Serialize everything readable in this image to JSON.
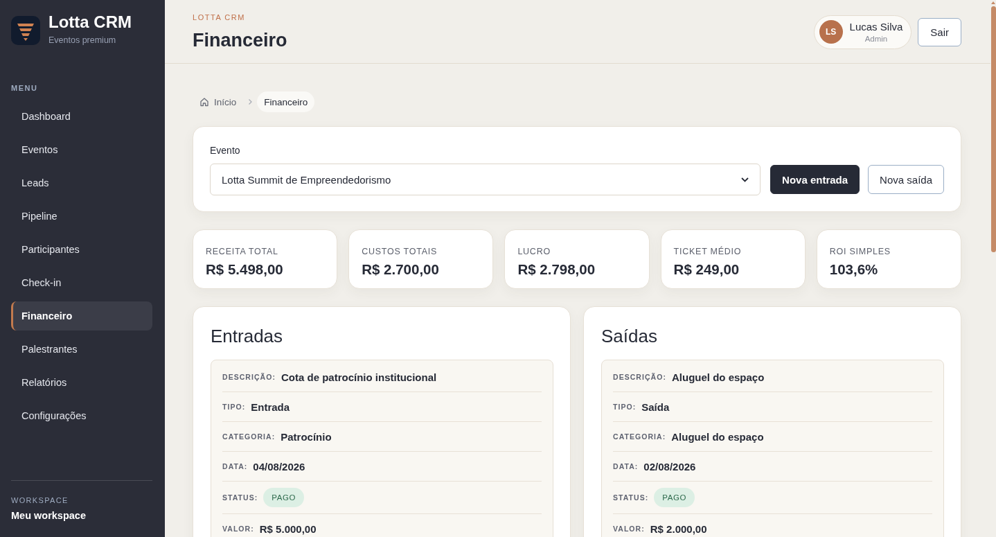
{
  "sidebar": {
    "brand": {
      "name": "Lotta CRM",
      "tagline": "Eventos premium"
    },
    "menu_label": "MENU",
    "items": [
      {
        "label": "Dashboard",
        "selected": false
      },
      {
        "label": "Eventos",
        "selected": false
      },
      {
        "label": "Leads",
        "selected": false
      },
      {
        "label": "Pipeline",
        "selected": false
      },
      {
        "label": "Participantes",
        "selected": false
      },
      {
        "label": "Check-in",
        "selected": false
      },
      {
        "label": "Financeiro",
        "selected": true
      },
      {
        "label": "Palestrantes",
        "selected": false
      },
      {
        "label": "Relatórios",
        "selected": false
      },
      {
        "label": "Configurações",
        "selected": false
      }
    ],
    "workspace": {
      "label": "WORKSPACE",
      "name": "Meu workspace"
    }
  },
  "header": {
    "eyebrow": "LOTTA CRM",
    "title": "Financeiro",
    "user": {
      "initials": "LS",
      "name": "Lucas Silva",
      "role": "Admin"
    },
    "logout": "Sair"
  },
  "breadcrumb": [
    {
      "label": "Início",
      "current": false
    },
    {
      "label": "Financeiro",
      "current": true
    }
  ],
  "event_filter": {
    "label": "Evento",
    "value": "Lotta Summit de Empreendedorismo",
    "buttons": [
      {
        "label": "Nova entrada",
        "kind": "primary"
      },
      {
        "label": "Nova saída",
        "kind": "secondary"
      }
    ]
  },
  "kpis": [
    {
      "label": "RECEITA TOTAL",
      "value": "R$ 5.498,00"
    },
    {
      "label": "CUSTOS TOTAIS",
      "value": "R$ 2.700,00"
    },
    {
      "label": "LUCRO",
      "value": "R$ 2.798,00"
    },
    {
      "label": "TICKET MÉDIO",
      "value": "R$ 249,00"
    },
    {
      "label": "ROI SIMPLES",
      "value": "103,6%"
    }
  ],
  "panels": [
    {
      "title": "Entradas",
      "records": [
        {
          "fields": [
            {
              "label": "DESCRIÇÃO:",
              "value": "Cota de patrocínio institucional",
              "kind": "text"
            },
            {
              "label": "TIPO:",
              "value": "Entrada",
              "kind": "text"
            },
            {
              "label": "CATEGORIA:",
              "value": "Patrocínio",
              "kind": "text"
            },
            {
              "label": "DATA:",
              "value": "04/08/2026",
              "kind": "text"
            },
            {
              "label": "STATUS:",
              "value": "PAGO",
              "kind": "badge"
            },
            {
              "label": "VALOR:",
              "value": "R$ 5.000,00",
              "kind": "text"
            }
          ]
        }
      ]
    },
    {
      "title": "Saídas",
      "records": [
        {
          "fields": [
            {
              "label": "DESCRIÇÃO:",
              "value": "Aluguel do espaço",
              "kind": "text"
            },
            {
              "label": "TIPO:",
              "value": "Saída",
              "kind": "text"
            },
            {
              "label": "CATEGORIA:",
              "value": "Aluguel do espaço",
              "kind": "text"
            },
            {
              "label": "DATA:",
              "value": "02/08/2026",
              "kind": "text"
            },
            {
              "label": "STATUS:",
              "value": "PAGO",
              "kind": "badge"
            },
            {
              "label": "VALOR:",
              "value": "R$ 2.000,00",
              "kind": "text"
            }
          ]
        }
      ]
    }
  ]
}
